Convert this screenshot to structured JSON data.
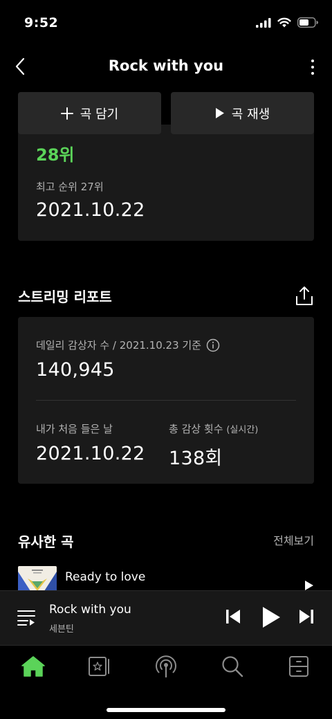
{
  "status": {
    "time": "9:52"
  },
  "header": {
    "title": "Rock with you"
  },
  "actions": {
    "add_label": "곡 담기",
    "play_label": "곡 재생"
  },
  "ranking": {
    "current": "28위",
    "best_label": "최고 순위 27위",
    "date": "2021.10.22"
  },
  "streaming": {
    "title": "스트리밍 리포트",
    "daily_label": "데일리 감상자 수 / 2021.10.23 기준",
    "daily_value": "140,945",
    "first_listen_label": "내가 처음 들은 날",
    "first_listen_value": "2021.10.22",
    "total_label": "총 감상 횟수",
    "total_sub": "(실시간)",
    "total_value": "138회"
  },
  "similar": {
    "title": "유사한 곡",
    "see_all": "전체보기",
    "items": [
      {
        "title": "Ready to love"
      }
    ]
  },
  "player": {
    "title": "Rock with you",
    "artist": "세븐틴"
  },
  "tabs": [
    {
      "icon": "home-icon",
      "active": true
    },
    {
      "icon": "library-icon",
      "active": false
    },
    {
      "icon": "podcast-icon",
      "active": false
    },
    {
      "icon": "search-icon",
      "active": false
    },
    {
      "icon": "storage-icon",
      "active": false
    }
  ],
  "colors": {
    "accent": "#5bd359",
    "background": "#000000",
    "card": "#1a1a1a",
    "button": "#282828",
    "muted": "#b3b3b3"
  }
}
